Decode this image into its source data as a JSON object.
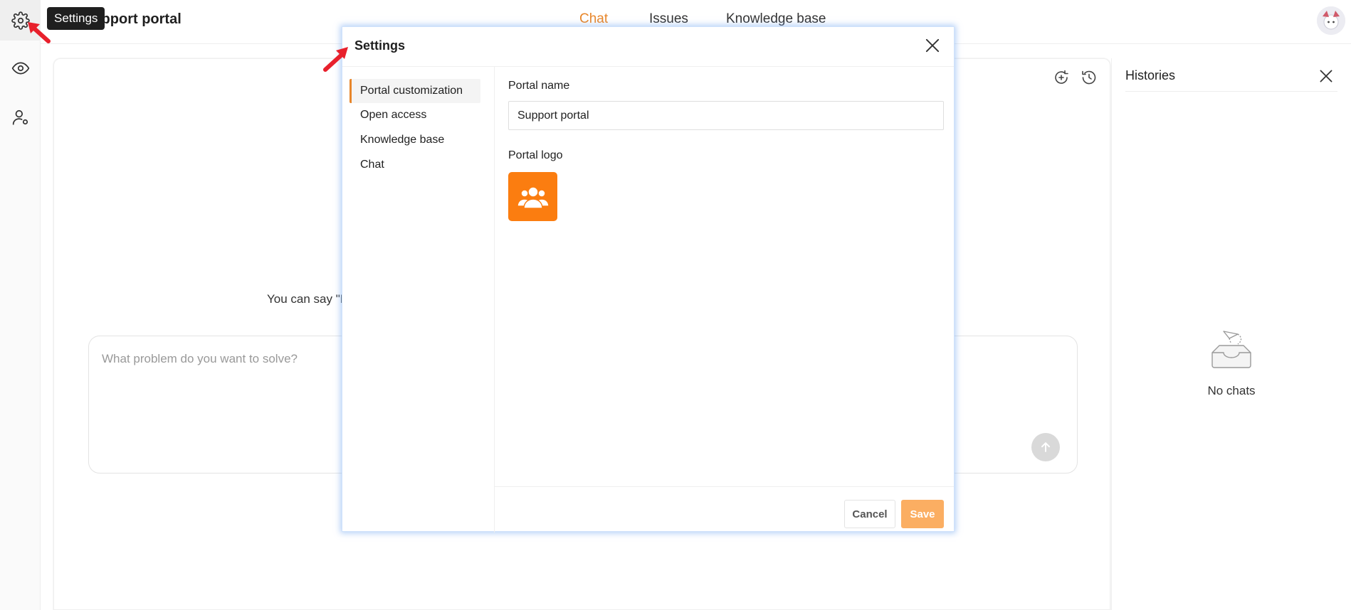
{
  "tooltip": {
    "text": "Settings"
  },
  "header": {
    "title": "Support portal",
    "tabs": [
      {
        "label": "Chat",
        "active": true
      },
      {
        "label": "Issues",
        "active": false
      },
      {
        "label": "Knowledge base",
        "active": false
      }
    ]
  },
  "rail": {
    "icons": [
      "gear-icon",
      "eye-icon",
      "user-settings-icon"
    ]
  },
  "main": {
    "hint": "You can say \"H",
    "composer_placeholder": "What problem do you want to solve?"
  },
  "histories": {
    "title": "Histories",
    "empty_text": "No chats"
  },
  "modal": {
    "title": "Settings",
    "nav": [
      {
        "label": "Portal customization",
        "active": true
      },
      {
        "label": "Open access",
        "active": false
      },
      {
        "label": "Knowledge base",
        "active": false
      },
      {
        "label": "Chat",
        "active": false
      }
    ],
    "portal_name_label": "Portal name",
    "portal_name_value": "Support portal",
    "portal_logo_label": "Portal logo",
    "cancel_label": "Cancel",
    "save_label": "Save"
  },
  "colors": {
    "accent": "#e8862a",
    "logo_bg": "#fb7d10",
    "save_bg": "#fbae62",
    "annotation": "#e8202c"
  }
}
